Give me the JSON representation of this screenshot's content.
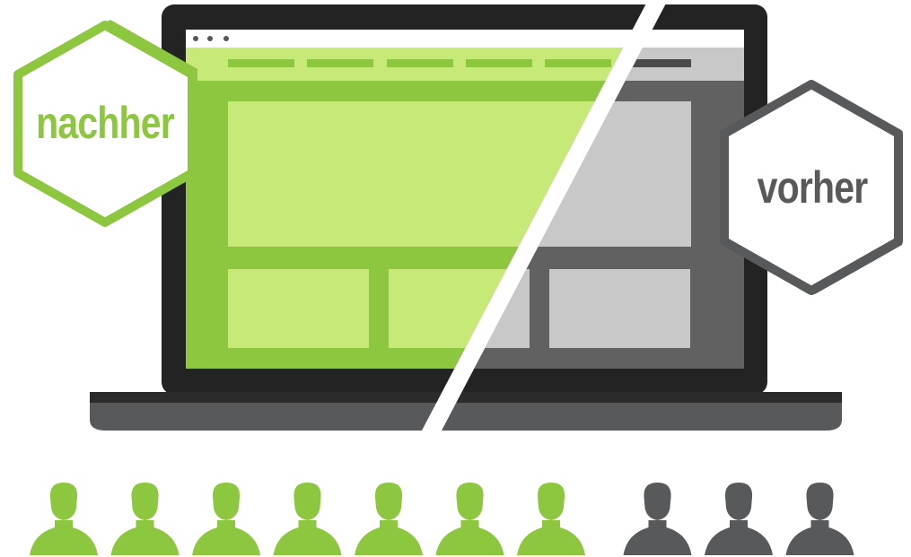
{
  "labels": {
    "after": "nachher",
    "before": "vorher"
  },
  "colors": {
    "green_dark": "#8dc63f",
    "green_light": "#c6e978",
    "gray_dark": "#58595b",
    "gray_light": "#c8c8c8",
    "laptop_frame": "#232323"
  },
  "audience": {
    "converted_icon": "person-icon-green",
    "remaining_icon": "person-icon-gray",
    "converted_count": 7,
    "remaining_count": 3
  }
}
